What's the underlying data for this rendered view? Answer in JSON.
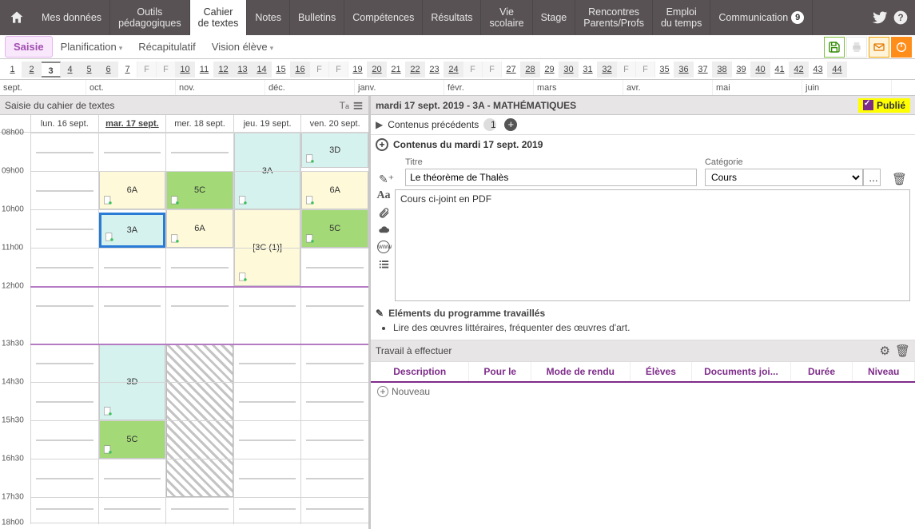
{
  "nav": {
    "tabs": [
      {
        "label": "Mes données"
      },
      {
        "label": "Outils\npédagogiques"
      },
      {
        "label": "Cahier\nde textes",
        "active": true
      },
      {
        "label": "Notes"
      },
      {
        "label": "Bulletins"
      },
      {
        "label": "Compétences"
      },
      {
        "label": "Résultats"
      },
      {
        "label": "Vie\nscolaire"
      },
      {
        "label": "Stage"
      },
      {
        "label": "Rencontres\nParents/Profs"
      },
      {
        "label": "Emploi\ndu temps"
      },
      {
        "label": "Communication",
        "badge": "9"
      }
    ]
  },
  "subnav": {
    "tabs": [
      {
        "label": "Saisie",
        "active": true
      },
      {
        "label": "Planification",
        "caret": true
      },
      {
        "label": "Récapitulatif"
      },
      {
        "label": "Vision élève",
        "caret": true
      }
    ]
  },
  "weeks": [
    {
      "n": "1"
    },
    {
      "n": "2",
      "dim": true
    },
    {
      "n": "3",
      "active": true
    },
    {
      "n": "4",
      "dim": true
    },
    {
      "n": "5",
      "dim": true
    },
    {
      "n": "6",
      "dim": true
    },
    {
      "n": "7"
    },
    {
      "n": "F",
      "f": true
    },
    {
      "n": "F",
      "f": true
    },
    {
      "n": "10",
      "dim": true
    },
    {
      "n": "11"
    },
    {
      "n": "12",
      "dim": true
    },
    {
      "n": "13",
      "dim": true
    },
    {
      "n": "14",
      "dim": true
    },
    {
      "n": "15"
    },
    {
      "n": "16",
      "dim": true
    },
    {
      "n": "F",
      "f": true
    },
    {
      "n": "F",
      "f": true
    },
    {
      "n": "19"
    },
    {
      "n": "20",
      "dim": true
    },
    {
      "n": "21"
    },
    {
      "n": "22",
      "dim": true
    },
    {
      "n": "23"
    },
    {
      "n": "24",
      "dim": true
    },
    {
      "n": "F",
      "f": true
    },
    {
      "n": "F",
      "f": true
    },
    {
      "n": "27"
    },
    {
      "n": "28",
      "dim": true
    },
    {
      "n": "29"
    },
    {
      "n": "30",
      "dim": true
    },
    {
      "n": "31"
    },
    {
      "n": "32",
      "dim": true
    },
    {
      "n": "F",
      "f": true
    },
    {
      "n": "F",
      "f": true
    },
    {
      "n": "35"
    },
    {
      "n": "36",
      "dim": true
    },
    {
      "n": "37"
    },
    {
      "n": "38",
      "dim": true
    },
    {
      "n": "39"
    },
    {
      "n": "40",
      "dim": true
    },
    {
      "n": "41"
    },
    {
      "n": "42",
      "dim": true
    },
    {
      "n": "43"
    },
    {
      "n": "44",
      "dim": true
    }
  ],
  "months": [
    "sept.",
    "oct.",
    "nov.",
    "déc.",
    "janv.",
    "févr.",
    "mars",
    "avr.",
    "mai",
    "juin"
  ],
  "left": {
    "title": "Saisie du cahier de textes",
    "days": [
      "lun. 16 sept.",
      "mar. 17 sept.",
      "mer. 18 sept.",
      "jeu. 19 sept.",
      "ven. 20 sept."
    ],
    "activeDay": 1,
    "hours": [
      "08h00",
      "09h00",
      "10h00",
      "11h00",
      "12h00",
      "13h30",
      "14h30",
      "15h30",
      "16h30",
      "17h30",
      "18h00"
    ]
  },
  "lessons": {
    "mar_3a": "3A",
    "mar_6a": "6A",
    "mar_3d": "3D",
    "mar_5c": "5C",
    "mer_5c": "5C",
    "mer_6a": "6A",
    "jeu_3a": "3A",
    "jeu_3c": "[3C (1)]",
    "ven_3d": "3D",
    "ven_6a": "6A",
    "ven_5c": "5C"
  },
  "right": {
    "header": "mardi 17 sept. 2019 - 3A - MATHÉMATIQUES",
    "publish": "Publié",
    "prev_label": "Contenus précédents",
    "prev_count": "1",
    "contents_label": "Contenus du mardi 17 sept. 2019",
    "titre_lbl": "Titre",
    "titre_val": "Le théorème de Thalès",
    "cat_lbl": "Catégorie",
    "cat_val": "Cours",
    "body": "Cours ci-joint en PDF",
    "prog_hd": "Eléments du programme travaillés",
    "prog_item": "Lire des œuvres littéraires, fréquenter des œuvres d'art.",
    "tav_title": "Travail à effectuer",
    "tav_cols": [
      "Description",
      "Pour le",
      "Mode de rendu",
      "Élèves",
      "Documents joi...",
      "Durée",
      "Niveau"
    ],
    "tav_new": "Nouveau"
  }
}
